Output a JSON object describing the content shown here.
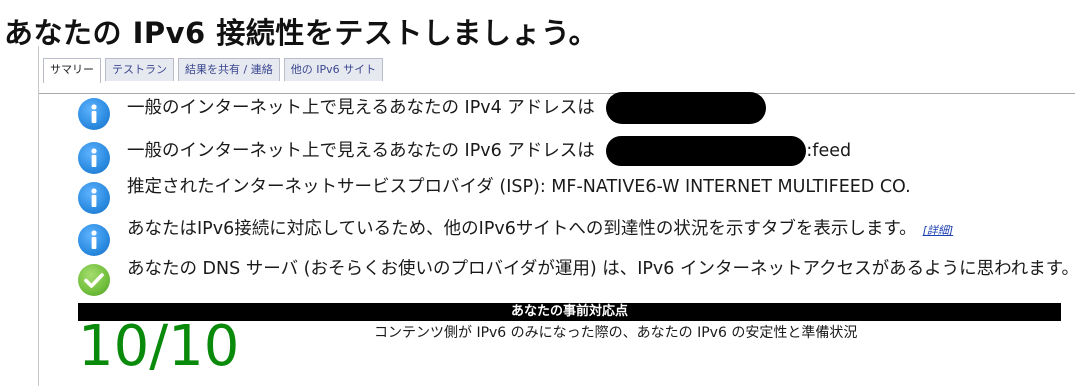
{
  "page": {
    "title": "あなたの IPv6 接続性をテストしましょう。"
  },
  "tabs": [
    {
      "label": "サマリー",
      "active": true
    },
    {
      "label": "テストラン",
      "active": false
    },
    {
      "label": "結果を共有 / 連絡",
      "active": false
    },
    {
      "label": "他の IPv6 サイト",
      "active": false
    }
  ],
  "summary": {
    "rows": [
      {
        "icon": "info-icon",
        "text": "一般のインターネット上で見えるあなたの IPv4 アドレスは",
        "suffix": ""
      },
      {
        "icon": "info-icon",
        "text": "一般のインターネット上で見えるあなたの IPv6 アドレスは",
        "suffix": ":feed"
      },
      {
        "icon": "info-icon",
        "text": "推定されたインターネットサービスプロバイダ (ISP): MF-NATIVE6-W INTERNET MULTIFEED CO."
      },
      {
        "icon": "info-icon",
        "text": "あなたはIPv6接続に対応しているため、他のIPv6サイトへの到達性の状況を示すタブを表示します。",
        "link": "[詳細]"
      },
      {
        "icon": "check-icon",
        "text": "あなたの DNS サーバ (おそらくお使いのプロバイダが運用) は、IPv6 インターネットアクセスがあるように思われます。"
      }
    ]
  },
  "readiness": {
    "header": "あなたの事前対応点",
    "score": "10/10",
    "description": "コンテンツ側が IPv6 のみになった際の、あなたの IPv6 の安定性と準備状況"
  },
  "colors": {
    "info": "#2b8be0",
    "ok": "#71bf3d",
    "score": "#0a8a0a",
    "tab_text": "#3b4890"
  }
}
